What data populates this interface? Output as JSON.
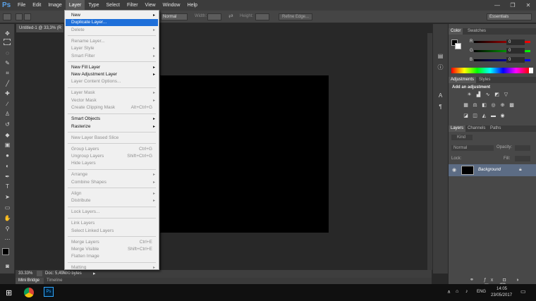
{
  "menubar": {
    "logo": "Ps",
    "items": [
      "File",
      "Edit",
      "Image",
      "Layer",
      "Type",
      "Select",
      "Filter",
      "View",
      "Window",
      "Help"
    ],
    "win_minimize": "—",
    "win_restore": "❐",
    "win_close": "✕"
  },
  "options": {
    "mode": "Normal",
    "width_label": "Width:",
    "height_label": "Height:",
    "refine_edge": "Refine Edge...",
    "workspace": "Essentials"
  },
  "document": {
    "tab_title": "Untitled-1 @ 33,3% (R"
  },
  "layer_menu": {
    "sections": [
      [
        {
          "label": "New",
          "sub": true,
          "enabled": true
        },
        {
          "label": "Duplicate Layer...",
          "enabled": true,
          "highlighted": true
        },
        {
          "label": "Delete",
          "sub": true,
          "enabled": false
        }
      ],
      [
        {
          "label": "Rename Layer...",
          "enabled": false
        },
        {
          "label": "Layer Style",
          "sub": true,
          "enabled": false
        },
        {
          "label": "Smart Filter",
          "sub": true,
          "enabled": false
        }
      ],
      [
        {
          "label": "New Fill Layer",
          "sub": true,
          "enabled": true
        },
        {
          "label": "New Adjustment Layer",
          "sub": true,
          "enabled": true
        },
        {
          "label": "Layer Content Options...",
          "enabled": false
        }
      ],
      [
        {
          "label": "Layer Mask",
          "sub": true,
          "enabled": false
        },
        {
          "label": "Vector Mask",
          "sub": true,
          "enabled": false
        },
        {
          "label": "Create Clipping Mask",
          "shortcut": "Alt+Ctrl+G",
          "enabled": false
        }
      ],
      [
        {
          "label": "Smart Objects",
          "sub": true,
          "enabled": true
        },
        {
          "label": "Rasterize",
          "sub": true,
          "enabled": true
        }
      ],
      [
        {
          "label": "New Layer Based Slice",
          "enabled": false
        }
      ],
      [
        {
          "label": "Group Layers",
          "shortcut": "Ctrl+G",
          "enabled": false
        },
        {
          "label": "Ungroup Layers",
          "shortcut": "Shift+Ctrl+G",
          "enabled": false
        },
        {
          "label": "Hide Layers",
          "enabled": false
        }
      ],
      [
        {
          "label": "Arrange",
          "sub": true,
          "enabled": false
        },
        {
          "label": "Combine Shapes",
          "sub": true,
          "enabled": false
        }
      ],
      [
        {
          "label": "Align",
          "sub": true,
          "enabled": false
        },
        {
          "label": "Distribute",
          "sub": true,
          "enabled": false
        }
      ],
      [
        {
          "label": "Lock Layers...",
          "enabled": false
        }
      ],
      [
        {
          "label": "Link Layers",
          "enabled": false
        },
        {
          "label": "Select Linked Layers",
          "enabled": false
        }
      ],
      [
        {
          "label": "Merge Layers",
          "shortcut": "Ctrl+E",
          "enabled": false
        },
        {
          "label": "Merge Visible",
          "shortcut": "Shift+Ctrl+E",
          "enabled": false
        },
        {
          "label": "Flatten Image",
          "enabled": false
        }
      ],
      [
        {
          "label": "Matting",
          "sub": true,
          "enabled": false
        }
      ]
    ]
  },
  "status": {
    "zoom": "33.33%",
    "doc": "Doc: 5,49M/0 bytes"
  },
  "bottom_tabs": {
    "mini_bridge": "Mini Bridge",
    "timeline": "Timeline"
  },
  "color_panel": {
    "tabs": [
      "Color",
      "Swatches"
    ],
    "r_label": "R",
    "g_label": "G",
    "b_label": "B",
    "r": "0",
    "g": "0",
    "b": "0",
    "fg": "#000000",
    "bg": "#ffffff"
  },
  "adjust_panel": {
    "tabs": [
      "Adjustments",
      "Styles"
    ],
    "title": "Add an adjustment"
  },
  "layers_panel": {
    "tabs": [
      "Layers",
      "Channels",
      "Paths"
    ],
    "kind": "Kind",
    "blend": "Normal",
    "opacity_label": "Opacity:",
    "lock_label": "Lock:",
    "fill_label": "Fill:",
    "layer_name": "Background"
  },
  "taskbar": {
    "time": "14:05",
    "date": "23/05/2017",
    "lang": "ENG"
  }
}
